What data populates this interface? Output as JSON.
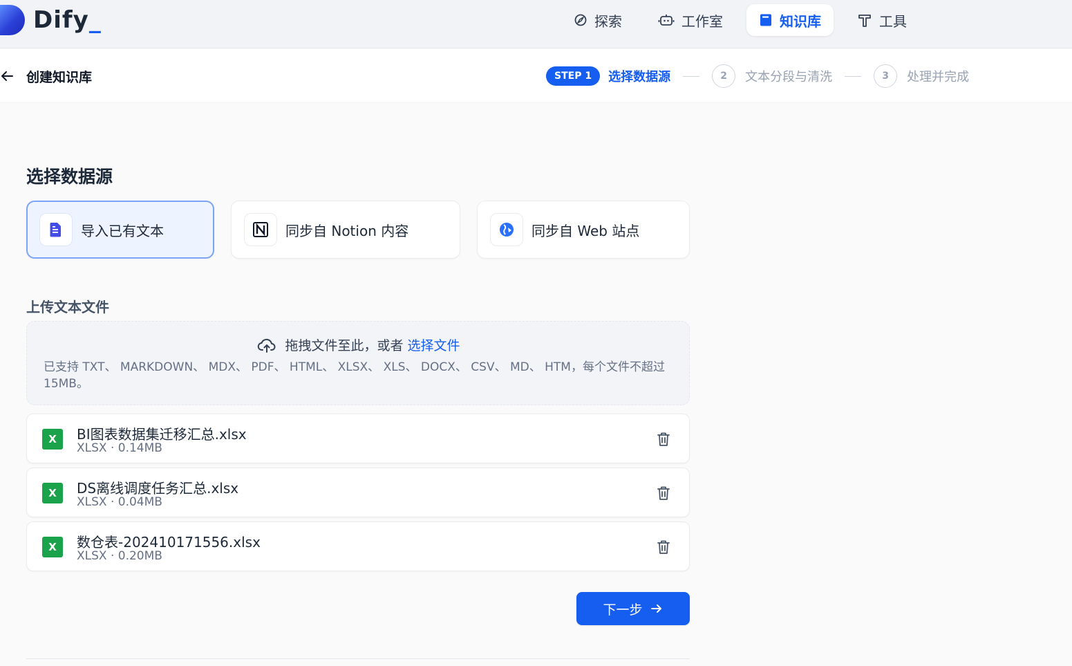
{
  "app": {
    "logo_text": "Dify",
    "logo_cursor": "_"
  },
  "nav": {
    "items": [
      {
        "label": "探索",
        "icon": "compass-icon"
      },
      {
        "label": "工作室",
        "icon": "robot-icon"
      },
      {
        "label": "知识库",
        "icon": "book-icon",
        "active": true
      },
      {
        "label": "工具",
        "icon": "hammer-icon"
      }
    ]
  },
  "header": {
    "title": "创建知识库",
    "steps": {
      "badge": "STEP 1",
      "step1_label": "选择数据源",
      "step2_num": "2",
      "step2_label": "文本分段与清洗",
      "step3_num": "3",
      "step3_label": "处理并完成"
    }
  },
  "main": {
    "section_title": "选择数据源",
    "sources": [
      {
        "label": "导入已有文本",
        "icon": "file-text-icon",
        "selected": true
      },
      {
        "label": "同步自 Notion 内容",
        "icon": "notion-icon"
      },
      {
        "label": "同步自 Web 站点",
        "icon": "globe-icon"
      }
    ],
    "upload": {
      "title": "上传文本文件",
      "drop_text": "拖拽文件至此，或者",
      "drop_link": "选择文件",
      "tip": "已支持 TXT、 MARKDOWN、 MDX、 PDF、 HTML、 XLSX、 XLS、 DOCX、 CSV、 MD、 HTM，每个文件不超过 15MB。"
    },
    "files": [
      {
        "name": "BI图表数据集迁移汇总.xlsx",
        "meta": "XLSX · 0.14MB",
        "icon_letter": "X"
      },
      {
        "name": "DS离线调度任务汇总.xlsx",
        "meta": "XLSX · 0.04MB",
        "icon_letter": "X"
      },
      {
        "name": "数仓表-202410171556.xlsx",
        "meta": "XLSX · 0.20MB",
        "icon_letter": "X"
      }
    ],
    "next_button": "下一步"
  },
  "colors": {
    "accent": "#155eef",
    "excel_green": "#1aa34a",
    "selected_bg": "#eef4ff"
  }
}
